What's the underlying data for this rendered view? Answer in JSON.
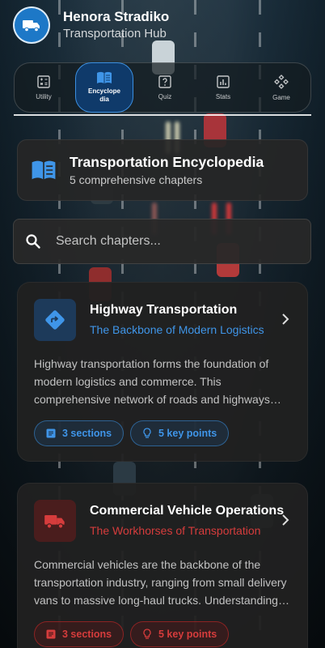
{
  "app": {
    "name": "Henora Stradiko",
    "subtitle": "Transportation Hub",
    "logo_icon": "truck-icon"
  },
  "nav": {
    "items": [
      {
        "label": "Utility",
        "icon": "calculator-icon",
        "active": false
      },
      {
        "label": "Encyclope\ndia",
        "icon": "book-icon",
        "active": true
      },
      {
        "label": "Quiz",
        "icon": "quiz-icon",
        "active": false
      },
      {
        "label": "Stats",
        "icon": "chart-icon",
        "active": false
      },
      {
        "label": "Game",
        "icon": "gamepad-icon",
        "active": false
      }
    ]
  },
  "hero": {
    "title": "Transportation Encyclopedia",
    "subtitle": "5 comprehensive chapters",
    "icon": "book-icon"
  },
  "search": {
    "placeholder": "Search chapters...",
    "value": ""
  },
  "chapters": [
    {
      "title": "Highway Transportation",
      "subtitle": "The Backbone of Modern Logistics",
      "icon": "directions-icon",
      "accent": "#3f95e8",
      "description": "Highway transportation forms the foundation of modern logistics and commerce. This comprehensive network of roads and highways connects communities and markets.",
      "sections": "3 sections",
      "key_points": "5 key points"
    },
    {
      "title": "Commercial Vehicle Operations",
      "subtitle": "The Workhorses of Transportation",
      "icon": "truck-icon",
      "accent": "#d63c3c",
      "description": "Commercial vehicles are the backbone of the transportation industry, ranging from small delivery vans to massive long-haul trucks. Understanding their operation is essential.",
      "sections": "3 sections",
      "key_points": "5 key points"
    }
  ]
}
